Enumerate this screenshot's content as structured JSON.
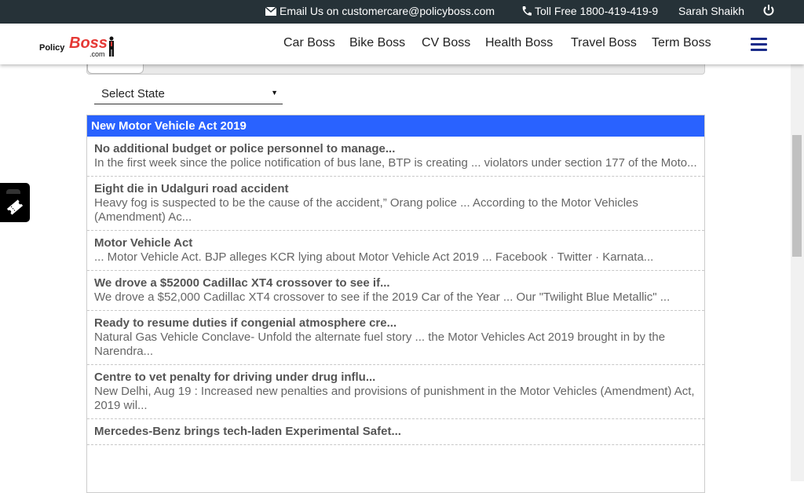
{
  "topbar": {
    "email_text": "Email Us on customercare@policyboss.com",
    "phone_text": "Toll Free 1800-419-419-9",
    "user_name": "Sarah Shaikh"
  },
  "logo": {
    "part1": "Policy",
    "part2": "Boss",
    "part3": ".com"
  },
  "nav": [
    "Car Boss",
    "Bike Boss",
    "CV Boss",
    "Health Boss",
    "Travel Boss",
    "Term Boss"
  ],
  "filter": {
    "state_label": "Select State"
  },
  "section": {
    "title": "New Motor Vehicle Act 2019"
  },
  "news": [
    {
      "title": "No additional budget or police personnel to manage...",
      "desc": "In the first week since the police notification of bus lane, BTP is creating ... violators under section 177 of the Moto..."
    },
    {
      "title": "Eight die in Udalguri road accident",
      "desc": "Heavy fog is suspected to be the cause of the accident,” Orang police ... According to the Motor Vehicles (Amendment) Ac..."
    },
    {
      "title": "Motor Vehicle Act",
      "desc": "... Motor Vehicle Act. BJP alleges KCR lying about Motor Vehicle Act 2019 ... Facebook · Twitter · Karnata..."
    },
    {
      "title": "We drove a $52000 Cadillac XT4 crossover to see if...",
      "desc": "We drove a $52,000 Cadillac XT4 crossover to see if the 2019 Car of the Year ... Our \"Twilight Blue Metallic\" ..."
    },
    {
      "title": "Ready to resume duties if congenial atmosphere cre...",
      "desc": "Natural Gas Vehicle Conclave- Unfold the alternate fuel story ... the Motor Vehicles Act 2019 brought in by the Narendra..."
    },
    {
      "title": "Centre to vet penalty for driving under drug influ...",
      "desc": "New Delhi, Aug 19 : Increased new penalties and provisions of punishment in the Motor Vehicles (Amendment) Act, 2019 wil..."
    },
    {
      "title": "Mercedes-Benz brings tech-laden Experimental Safet...",
      "desc": ""
    }
  ],
  "colors": {
    "topbar_bg": "#263238",
    "accent_blue": "#2962ff",
    "hamburger": "#1a2b8a"
  },
  "icons": {
    "email": "envelope-icon",
    "phone": "phone-icon",
    "power": "power-icon",
    "menu": "hamburger-icon",
    "side": "ticket-icon"
  }
}
